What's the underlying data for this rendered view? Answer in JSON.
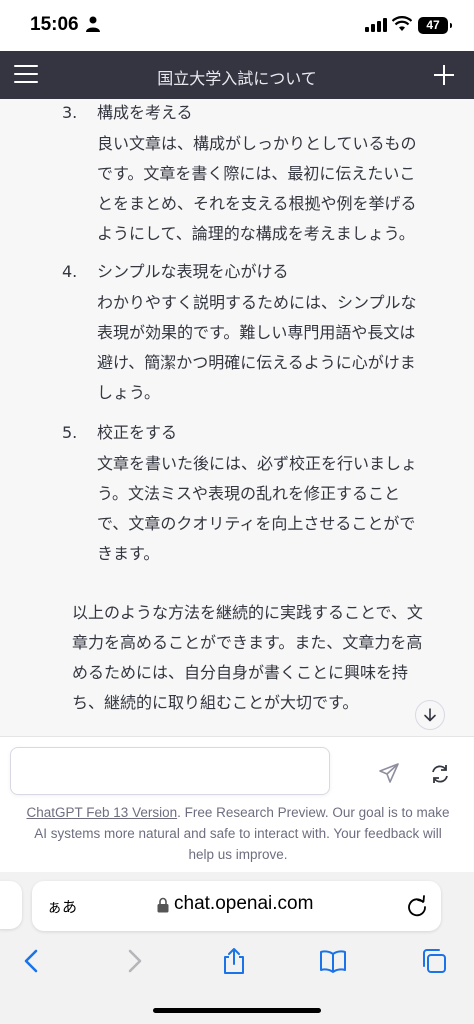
{
  "status": {
    "time": "15:06",
    "battery": "47"
  },
  "header": {
    "title": "国立大学入試について"
  },
  "items": [
    {
      "number": "3.",
      "title": "構成を考える",
      "lines": [
        "良い文章は、構成がしっかりとしているもの",
        "です。文章を書く際には、最初に伝えたいこ",
        "とをまとめ、それを支える根拠や例を挙げる",
        "ようにして、論理的な構成を考えましょう。"
      ]
    },
    {
      "number": "4.",
      "title": "シンプルな表現を心がける",
      "lines": [
        "わかりやすく説明するためには、シンプルな",
        "表現が効果的です。難しい専門用語や長文は",
        "避け、簡潔かつ明確に伝えるように心がけま",
        "しょう。"
      ]
    },
    {
      "number": "5.",
      "title": "校正をする",
      "lines": [
        "文章を書いた後には、必ず校正を行いましょ",
        "う。文法ミスや表現の乱れを修正すること",
        "で、文章のクオリティを向上させることがで",
        "きます。"
      ]
    }
  ],
  "summary": [
    "以上のような方法を継続的に実践することで、文",
    "章力を高めることができます。また、文章力を高",
    "めるためには、自分自身が書くことに興味を持",
    "ち、継続的に取り組むことが大切です。"
  ],
  "composer": {
    "placeholder": ""
  },
  "footer": {
    "version_link": "ChatGPT Feb 13 Version",
    "text_1": ". Free Research Preview. Our goal is to make",
    "text_2": "AI systems more natural and safe to interact with. Your feedback will",
    "text_3": "help us improve."
  },
  "browser": {
    "aa_label": "ぁあ",
    "url": "chat.openai.com"
  },
  "icons": {
    "menu": "hamburger-icon",
    "new_chat": "plus-icon",
    "scroll": "arrow-down-icon",
    "send": "paper-plane-icon",
    "regenerate": "refresh-icon",
    "lock": "lock-icon",
    "reload": "reload-icon",
    "back": "chevron-left-icon",
    "forward": "chevron-right-icon",
    "share": "share-icon",
    "bookmarks": "book-icon",
    "tabs": "tabs-icon"
  },
  "colors": {
    "header_bg": "#343541",
    "conversation_bg": "#f7f7f8",
    "safari_blue": "#1a73e8"
  }
}
